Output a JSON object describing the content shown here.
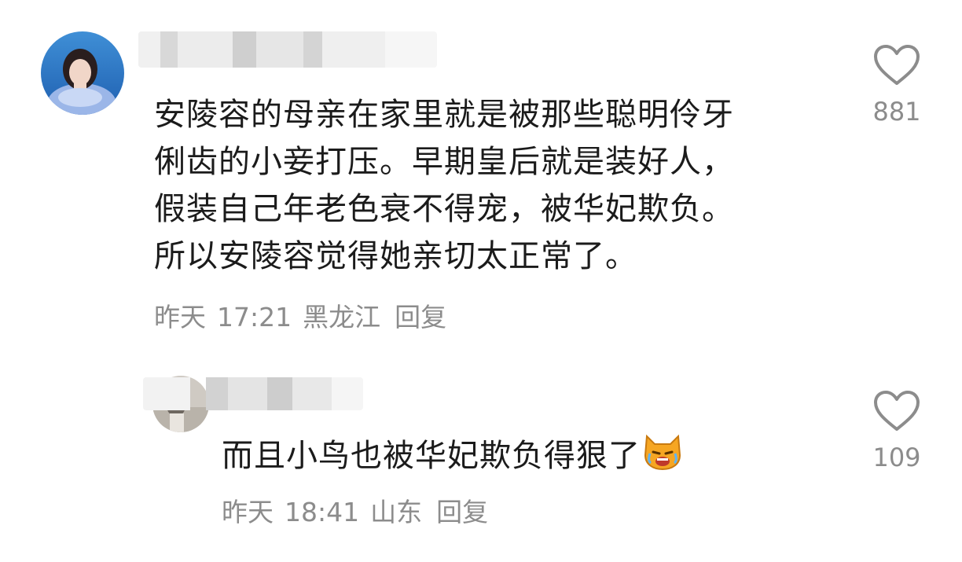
{
  "comments": [
    {
      "text_lines": [
        "安陵容的母亲在家里就是被那些聪明伶牙",
        "俐齿的小妾打压。早期皇后就是装好人，",
        "假装自己年老色衰不得宠，被华妃欺负。",
        "所以安陵容觉得她亲切太正常了。"
      ],
      "date": "昨天",
      "time": "17:21",
      "location": "黑龙江",
      "reply_label": "回复",
      "like_count": "881",
      "heart_icon": "heart-outline-icon"
    },
    {
      "text": "而且小鸟也被华妃欺负得狠了",
      "emoji_icon": "crying-cat-emoji-icon",
      "date": "昨天",
      "time": "18:41",
      "location": "山东",
      "reply_label": "回复",
      "like_count": "109",
      "heart_icon": "heart-outline-icon"
    }
  ],
  "colors": {
    "text": "#1b1b1b",
    "meta": "#8c8c8c",
    "icon": "#8c8c8c",
    "background": "#ffffff"
  }
}
